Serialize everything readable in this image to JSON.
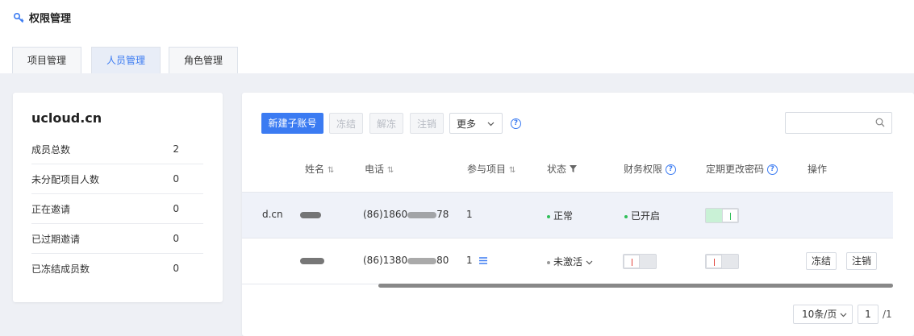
{
  "page": {
    "title": "权限管理",
    "title_icon": "key-icon"
  },
  "tabs": [
    {
      "label": "项目管理",
      "active": false
    },
    {
      "label": "人员管理",
      "active": true
    },
    {
      "label": "角色管理",
      "active": false
    }
  ],
  "summary": {
    "domain": "ucloud.cn",
    "stats": [
      {
        "label": "成员总数",
        "value": "2"
      },
      {
        "label": "未分配项目人数",
        "value": "0"
      },
      {
        "label": "正在邀请",
        "value": "0"
      },
      {
        "label": "已过期邀请",
        "value": "0"
      },
      {
        "label": "已冻结成员数",
        "value": "0"
      }
    ]
  },
  "toolbar": {
    "new_account": "新建子账号",
    "freeze": "冻结",
    "unfreeze": "解冻",
    "cancel": "注销",
    "more": "更多",
    "search_placeholder": ""
  },
  "table": {
    "headers": {
      "name": "姓名",
      "phone": "电话",
      "projects": "参与项目",
      "status": "状态",
      "finance": "财务权限",
      "password": "定期更改密码",
      "ops": "操作"
    },
    "rows": [
      {
        "email_fragment": "d.cn",
        "phone": "(86)1860",
        "phone_end": "78",
        "projects": "1",
        "status": "正常",
        "finance": "已开启",
        "finance_on": true,
        "password_on": true
      },
      {
        "email_fragment": "",
        "phone": "(86)1380",
        "phone_end": "80",
        "projects": "1",
        "status": "未激活",
        "finance_on": false,
        "password_on": false,
        "op_freeze": "冻结",
        "op_cancel": "注销"
      }
    ]
  },
  "pagination": {
    "page_size": "10条/页",
    "current": "1",
    "total": "/1"
  },
  "colors": {
    "accent": "#3b7bf2",
    "success": "#2fbf59",
    "danger": "#e2463f",
    "muted": "#999999"
  }
}
